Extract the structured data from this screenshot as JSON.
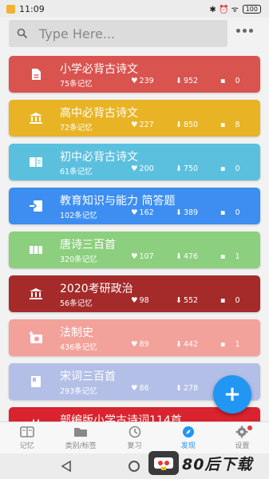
{
  "status": {
    "time": "11:09",
    "icons": "✱ ⏰ ᯤ",
    "battery": "100"
  },
  "search": {
    "placeholder": "Type Here..."
  },
  "cards": [
    {
      "title": "小学必背古诗文",
      "count": "75条记忆",
      "likes": "239",
      "downloads": "952",
      "comments": "0",
      "color": "#d9534f",
      "icon": "document-icon"
    },
    {
      "title": "高中必背古诗文",
      "count": "72条记忆",
      "likes": "227",
      "downloads": "850",
      "comments": "8",
      "color": "#e8b425",
      "icon": "bank-icon"
    },
    {
      "title": "初中必背古诗文",
      "count": "61条记忆",
      "likes": "200",
      "downloads": "750",
      "comments": "0",
      "color": "#5bc0de",
      "icon": "book-icon"
    },
    {
      "title": "教育知识与能力 简答题",
      "count": "102条记忆",
      "likes": "162",
      "downloads": "389",
      "comments": "0",
      "color": "#3d8ef0",
      "icon": "import-icon"
    },
    {
      "title": "唐诗三百首",
      "count": "320条记忆",
      "likes": "107",
      "downloads": "476",
      "comments": "1",
      "color": "#8ccf7e",
      "icon": "columns-icon"
    },
    {
      "title": "2020考研政治",
      "count": "56条记忆",
      "likes": "98",
      "downloads": "552",
      "comments": "0",
      "color": "#a52a2a",
      "icon": "bank-icon"
    },
    {
      "title": "法制史",
      "count": "436条记忆",
      "likes": "89",
      "downloads": "442",
      "comments": "1",
      "color": "#f2a29b",
      "icon": "add-photo-icon"
    },
    {
      "title": "宋词三百首",
      "count": "293条记忆",
      "likes": "86",
      "downloads": "278",
      "comments": "",
      "color": "#b3bfe6",
      "icon": "book-closed-icon"
    },
    {
      "title": "部编版小学古诗词114首",
      "count": "",
      "likes": "",
      "downloads": "",
      "comments": "",
      "color": "#d9232e",
      "icon": "calendar-icon"
    }
  ],
  "fab": {
    "label": "+"
  },
  "nav": [
    {
      "label": "记忆",
      "icon": "book-icon",
      "active": false
    },
    {
      "label": "类别/标签",
      "icon": "folder-icon",
      "active": false
    },
    {
      "label": "复习",
      "icon": "clock-icon",
      "active": false
    },
    {
      "label": "发现",
      "icon": "compass-icon",
      "active": true
    },
    {
      "label": "设置",
      "icon": "gear-icon",
      "active": false
    }
  ],
  "watermark": {
    "text": "80后下载"
  },
  "accent": "#2196f3"
}
